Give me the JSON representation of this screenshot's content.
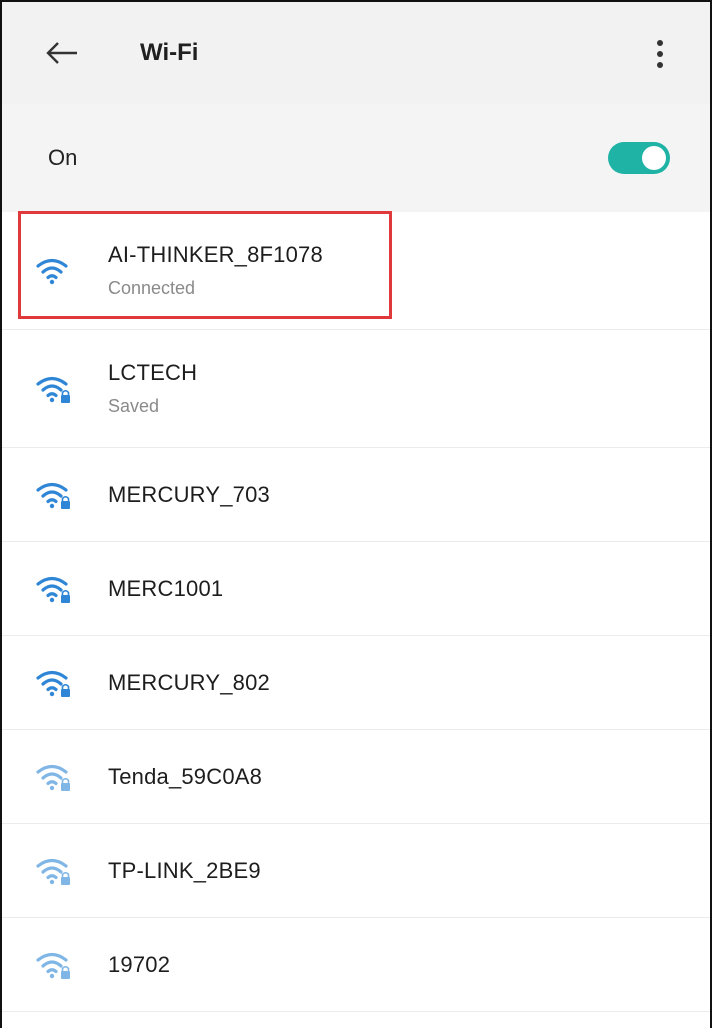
{
  "header": {
    "title": "Wi-Fi",
    "back_icon": "arrow-left-icon",
    "menu_icon": "more-vert-icon"
  },
  "wifi_toggle": {
    "label": "On",
    "state": "on",
    "color": "#1fb3a6"
  },
  "networks": [
    {
      "ssid": "AI-THINKER_8F1078",
      "status": "Connected",
      "secured": false,
      "signal": "strong",
      "icon": "wifi-icon"
    },
    {
      "ssid": "LCTECH",
      "status": "Saved",
      "secured": true,
      "signal": "strong",
      "icon": "wifi-lock-icon"
    },
    {
      "ssid": "MERCURY_703",
      "status": "",
      "secured": true,
      "signal": "strong",
      "icon": "wifi-lock-icon"
    },
    {
      "ssid": "MERC1001",
      "status": "",
      "secured": true,
      "signal": "strong",
      "icon": "wifi-lock-icon"
    },
    {
      "ssid": "MERCURY_802",
      "status": "",
      "secured": true,
      "signal": "strong",
      "icon": "wifi-lock-icon"
    },
    {
      "ssid": "Tenda_59C0A8",
      "status": "",
      "secured": true,
      "signal": "weak",
      "icon": "wifi-lock-icon"
    },
    {
      "ssid": "TP-LINK_2BE9",
      "status": "",
      "secured": true,
      "signal": "weak",
      "icon": "wifi-lock-icon"
    },
    {
      "ssid": "19702",
      "status": "",
      "secured": true,
      "signal": "weak",
      "icon": "wifi-lock-icon"
    }
  ],
  "colors": {
    "wifi_strong": "#2f86d6",
    "wifi_weak": "#7fb6e6",
    "highlight_border": "#e0393c"
  }
}
